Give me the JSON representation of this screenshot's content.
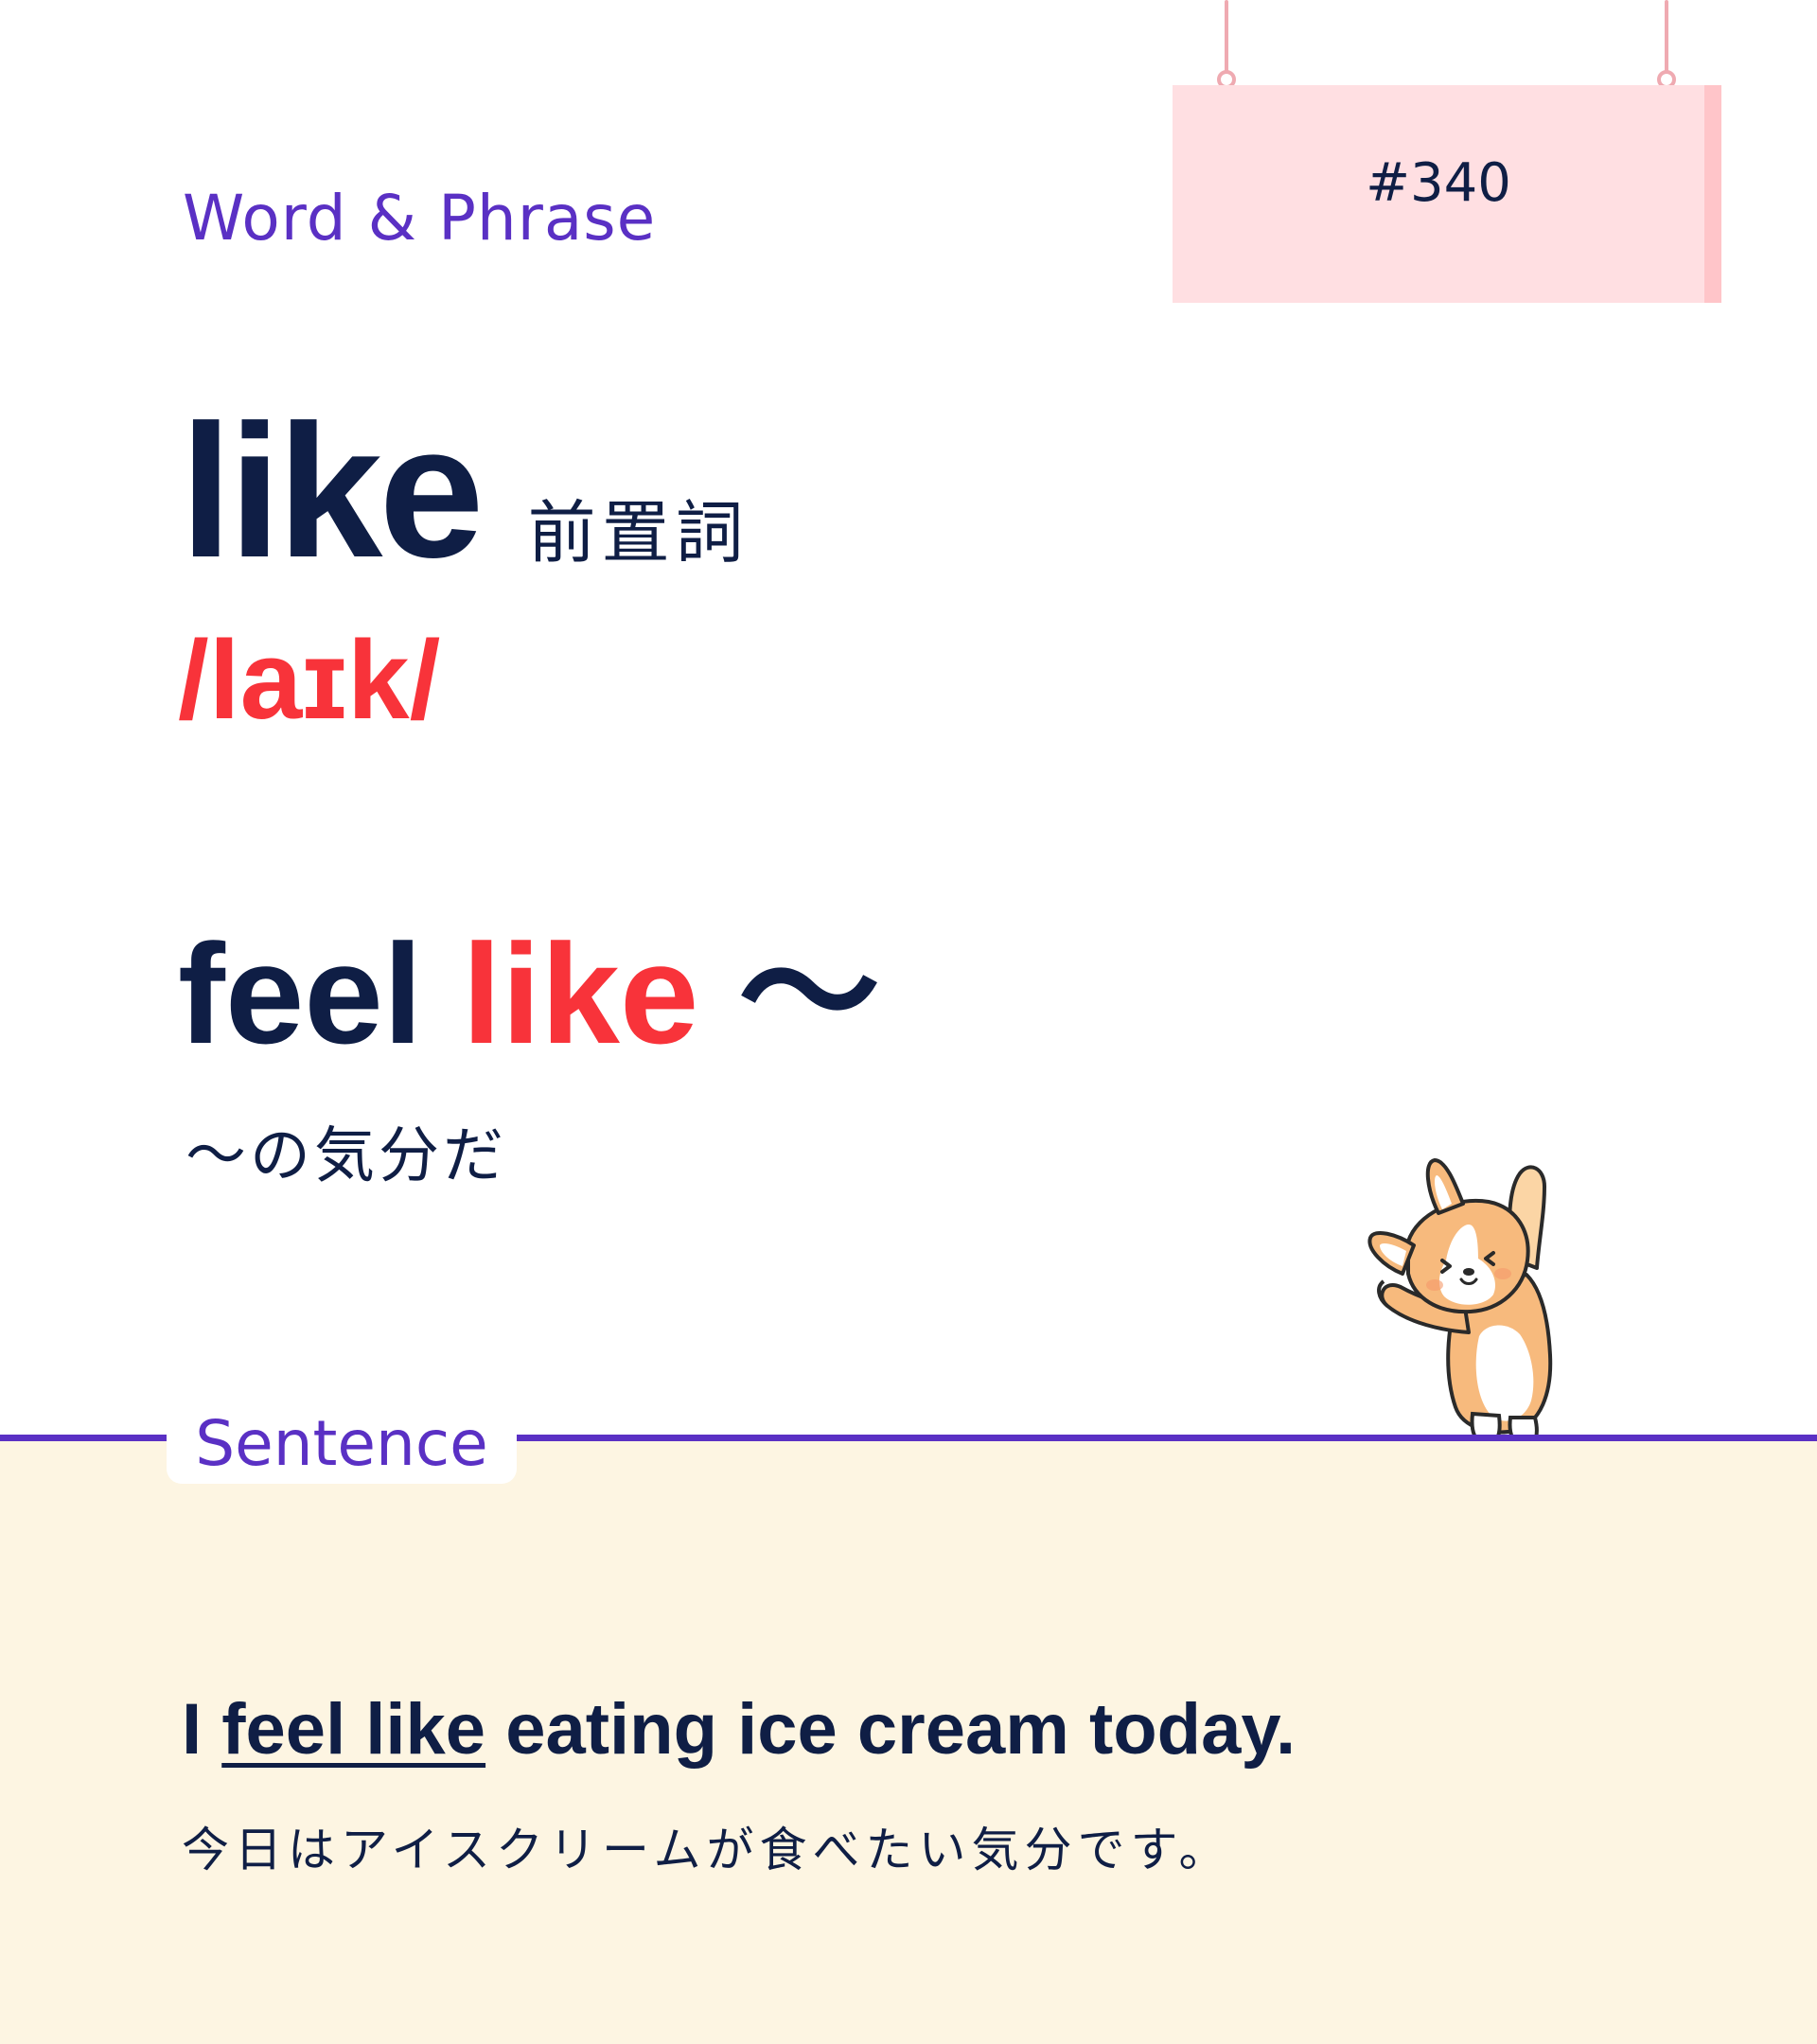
{
  "header": {
    "category": "Word & Phrase",
    "card_number": "#340"
  },
  "word": {
    "headword": "like",
    "part_of_speech": "前置詞",
    "pronunciation": "/laɪk/"
  },
  "phrase": {
    "before": "feel ",
    "highlight": "like",
    "after": " 〜",
    "meaning": "〜の気分だ"
  },
  "sentence": {
    "label": "Sentence",
    "english_before": "I ",
    "english_highlight": "feel like",
    "english_after": " eating ice cream today.",
    "japanese": "今日はアイスクリームが食べたい気分です。"
  },
  "illustration": {
    "icon": "corgi-stretching-icon"
  },
  "colors": {
    "accent_purple": "#5a30c4",
    "accent_red": "#f8333a",
    "text_navy": "#0f1e45",
    "sign_pink": "#ffdfe2",
    "bottom_cream": "#fdf5e2"
  }
}
